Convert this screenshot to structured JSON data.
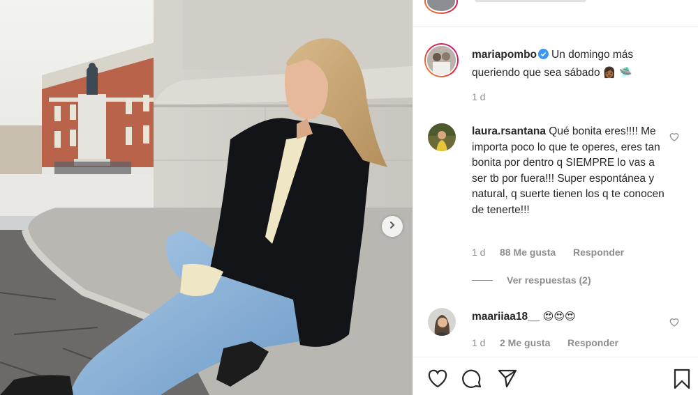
{
  "post": {
    "author": "mariapombo",
    "caption_text": "Un domingo más queriendo que sea sábado",
    "caption_emojis": "👩🏾 🛸",
    "time": "1 d"
  },
  "comments": [
    {
      "username": "laura.rsantana",
      "text": "Qué bonita eres!!!! Me importa poco lo que te operes, eres tan bonita por dentro q SIEMPRE lo vas a ser tb por fuera!!! Super espontánea y natural, q suerte tienen los q te conocen de tenerte!!!",
      "time": "1 d",
      "likes": "88 Me gusta",
      "reply_label": "Responder",
      "view_replies": "Ver respuestas (2)"
    },
    {
      "username": "maariiaa18__",
      "text": "😍😍😍",
      "time": "1 d",
      "likes": "2 Me gusta",
      "reply_label": "Responder"
    }
  ],
  "icons": {
    "verified": "verified-badge-icon",
    "like": "heart-icon",
    "comment": "comment-icon",
    "share": "paper-plane-icon",
    "save": "bookmark-icon",
    "carousel_next": "chevron-right-icon"
  },
  "colors": {
    "text": "#262626",
    "muted": "#8e8e8e",
    "verified": "#3897f0",
    "divider": "#efefef"
  }
}
